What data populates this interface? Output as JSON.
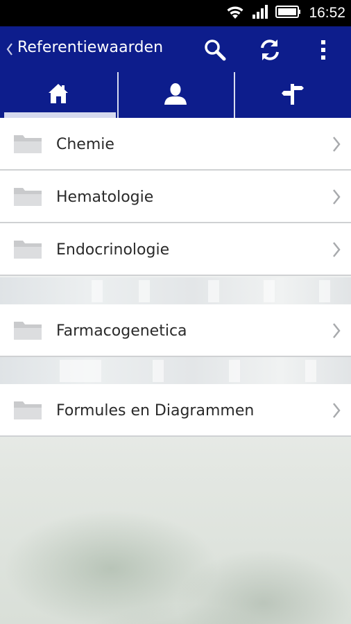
{
  "status_bar": {
    "time": "16:52",
    "icons": [
      "wifi-icon",
      "signal-icon",
      "battery-icon"
    ]
  },
  "action_bar": {
    "title": "Referentiewaarden",
    "actions": [
      "search-icon",
      "refresh-icon",
      "overflow-menu-icon"
    ],
    "background_color": "#0d1d8c"
  },
  "tabs": [
    {
      "icon": "home-icon",
      "selected": true
    },
    {
      "icon": "person-icon",
      "selected": false
    },
    {
      "icon": "signpost-icon",
      "selected": false
    }
  ],
  "list": {
    "groups": [
      {
        "items": [
          {
            "label": "Chemie",
            "icon": "folder-icon"
          },
          {
            "label": "Hematologie",
            "icon": "folder-icon"
          },
          {
            "label": "Endocrinologie",
            "icon": "folder-icon"
          }
        ]
      },
      {
        "items": [
          {
            "label": "Farmacogenetica",
            "icon": "folder-icon"
          }
        ]
      },
      {
        "items": [
          {
            "label": "Formules en Diagrammen",
            "icon": "folder-icon"
          }
        ]
      }
    ]
  }
}
